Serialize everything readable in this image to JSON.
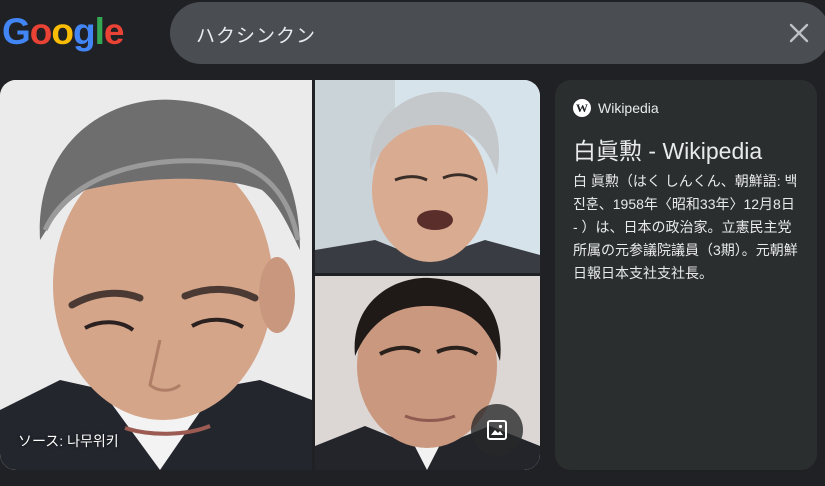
{
  "logo": {
    "text": "Google"
  },
  "search": {
    "query": "ハクシンクン"
  },
  "images": {
    "source_label": "ソース: 나무위키"
  },
  "knowledge_card": {
    "source_name": "Wikipedia",
    "source_icon": "W",
    "title": "白眞勲 - Wikipedia",
    "snippet": "白 眞勲（はく しんくん、朝鮮語: 백진훈、1958年〈昭和33年〉12月8日 - ）は、日本の政治家。立憲民主党所属の元参議院議員（3期）。元朝鮮日報日本支社支社長。"
  },
  "colors": {
    "background": "#202124",
    "search_bar": "#4a4d52",
    "card": "#2b2e2f"
  },
  "icons": {
    "clear": "close-icon",
    "lens": "image-search-icon",
    "source": "wikipedia-icon"
  }
}
